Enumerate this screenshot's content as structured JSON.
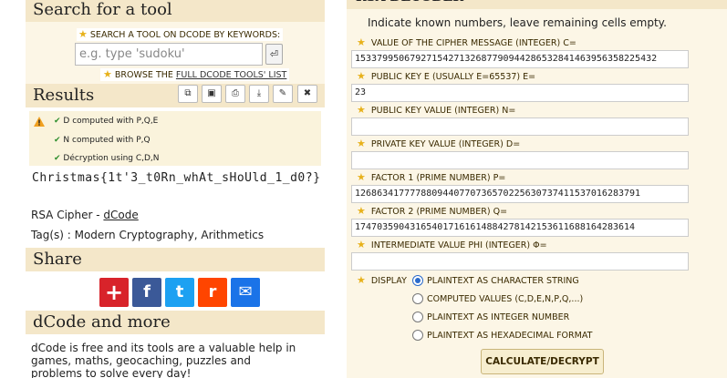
{
  "search": {
    "title": "Search for a tool",
    "keywords_label": "SEARCH A TOOL ON DCODE BY KEYWORDS:",
    "placeholder": "e.g. type 'sudoku'",
    "go_icon": "⏎",
    "browse_prefix": "BROWSE THE ",
    "browse_link": "FULL DCODE TOOLS' LIST"
  },
  "results": {
    "title": "Results",
    "toolbar": [
      {
        "name": "copy-icon",
        "glyph": "⧉"
      },
      {
        "name": "save-icon",
        "glyph": "▣"
      },
      {
        "name": "print-icon",
        "glyph": "⎙"
      },
      {
        "name": "download-icon",
        "glyph": "⤓"
      },
      {
        "name": "pin-icon",
        "glyph": "✎"
      },
      {
        "name": "close-icon",
        "glyph": "✖"
      }
    ],
    "log": [
      "D computed with P,Q,E",
      "N computed with P,Q",
      "Décryption using C,D,N"
    ],
    "output": "Christmas{1t'3_t0Rn_whAt_sHoUld_1_d0?}",
    "cipher_prefix": "RSA Cipher - ",
    "cipher_link": "dCode",
    "tags": "Tag(s) : Modern Cryptography, Arithmetics"
  },
  "share": {
    "title": "Share",
    "icons": [
      {
        "name": "share-plus-icon",
        "glyph": "+",
        "color": "#d8232a"
      },
      {
        "name": "facebook-icon",
        "glyph": "f",
        "color": "#3b5998"
      },
      {
        "name": "twitter-icon",
        "glyph": "t",
        "color": "#1da1f2"
      },
      {
        "name": "reddit-icon",
        "glyph": "r",
        "color": "#ff4500"
      },
      {
        "name": "email-icon",
        "glyph": "✉",
        "color": "#1a73e8"
      }
    ]
  },
  "more": {
    "title": "dCode and more",
    "text": "dCode is free and its tools are a valuable help in games, maths, geocaching, puzzles and problems to solve every day!"
  },
  "decoder": {
    "title": "RSA DECODER",
    "intro": "Indicate known numbers, leave remaining cells empty.",
    "fields": [
      {
        "label": "VALUE OF THE CIPHER MESSAGE (INTEGER) C=",
        "value": "1533799506792715427132687790944286532841463956358225432"
      },
      {
        "label": "PUBLIC KEY E (USUALLY E=65537) E=",
        "value": "23"
      },
      {
        "label": "PUBLIC KEY VALUE (INTEGER) N=",
        "value": ""
      },
      {
        "label": "PRIVATE KEY VALUE (INTEGER) D=",
        "value": ""
      },
      {
        "label": "FACTOR 1 (PRIME NUMBER) P=",
        "value": "1268634177778809440770736570225630737411537016283791"
      },
      {
        "label": "FACTOR 2 (PRIME NUMBER) Q=",
        "value": "174703590431654017161614884278142153611688164283614"
      },
      {
        "label": "INTERMEDIATE VALUE PHI (INTEGER) Φ=",
        "value": ""
      }
    ],
    "display_label": "DISPLAY",
    "display_options": [
      {
        "label": "PLAINTEXT AS CHARACTER STRING",
        "selected": true
      },
      {
        "label": "COMPUTED VALUES (C,D,E,N,P,Q,...)",
        "selected": false
      },
      {
        "label": "PLAINTEXT AS INTEGER NUMBER",
        "selected": false
      },
      {
        "label": "PLAINTEXT AS HEXADECIMAL FORMAT",
        "selected": false
      }
    ],
    "button": "CALCULATE/DECRYPT"
  }
}
